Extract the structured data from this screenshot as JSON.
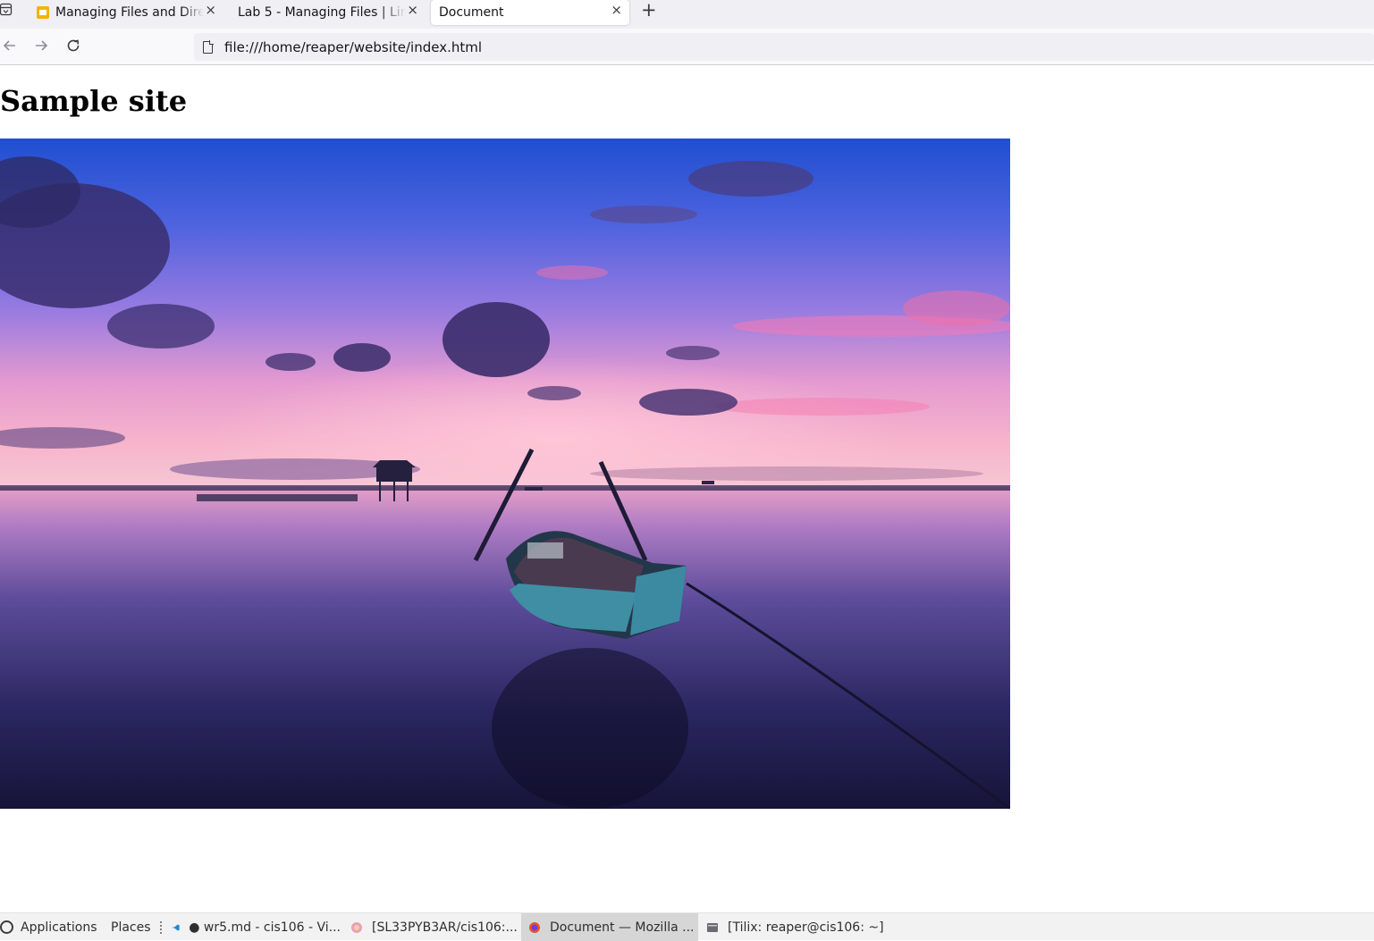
{
  "browser": {
    "tabs": [
      {
        "title": "Managing Files and Directories",
        "active": false
      },
      {
        "title": "Lab 5 - Managing Files | Linux",
        "active": false
      },
      {
        "title": "Document",
        "active": true
      }
    ],
    "new_tab_label": "+",
    "url": "file:///home/reaper/website/index.html"
  },
  "page": {
    "heading": "Sample site",
    "image_alt": "Boat at sunset on a calm sea"
  },
  "taskbar": {
    "applications": "Applications",
    "places": "Places",
    "tasks": [
      {
        "label": "● wr5.md - cis106 - Vi...",
        "icon": "vscode-icon",
        "active": false
      },
      {
        "label": "[SL33PYB3AR/cis106:...",
        "icon": "browser-icon",
        "active": false
      },
      {
        "label": "Document — Mozilla ...",
        "icon": "firefox-icon",
        "active": true
      },
      {
        "label": "[Tilix: reaper@cis106: ~]",
        "icon": "terminal-icon",
        "active": false
      }
    ]
  },
  "colors": {
    "tabstrip_bg": "#f0f0f4",
    "urlbar_bg": "#f0f0f4",
    "sky_top": "#2f56c8",
    "horizon_pink": "#f3a6c8",
    "water_dark": "#1c1a45"
  }
}
